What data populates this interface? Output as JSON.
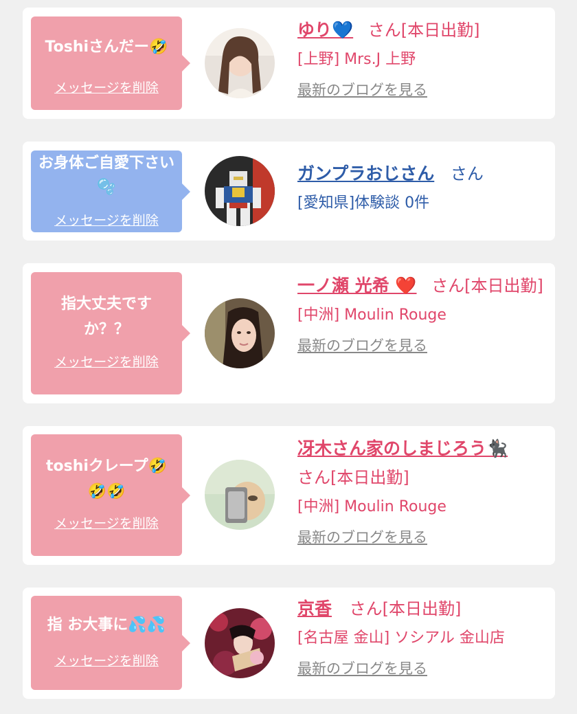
{
  "items": [
    {
      "message": "Toshiさんだー🤣",
      "delete_label": "メッセージを削除",
      "name": "ゆり💙",
      "suffix": "さん[本日出勤]",
      "shop": "[上野] Mrs.J 上野",
      "blog_label": "最新のブログを見る"
    },
    {
      "message": "お身体ご自愛下さい🫧",
      "delete_label": "メッセージを削除",
      "name": "ガンプラおじさん",
      "suffix": "さん",
      "shop": "[愛知県]体験談 0件"
    },
    {
      "message": "指大丈夫ですか？？",
      "delete_label": "メッセージを削除",
      "name": "一ノ瀬 光希 ❤️",
      "suffix": "さん[本日出勤]",
      "shop": "[中洲] Moulin Rouge",
      "blog_label": "最新のブログを見る"
    },
    {
      "message": "toshiクレープ🤣🤣🤣",
      "delete_label": "メッセージを削除",
      "name": "冴木さん家のしまじろう🐈‍⬛",
      "suffix": "さん[本日出勤]",
      "shop": "[中洲] Moulin Rouge",
      "blog_label": "最新のブログを見る"
    },
    {
      "message": "指 お大事に💦💦",
      "delete_label": "メッセージを削除",
      "name": "京香",
      "suffix": "さん[本日出勤]",
      "shop": "[名古屋 金山] ソシアル 金山店",
      "blog_label": "最新のブログを見る"
    }
  ],
  "colors": {
    "bubble_pink": "#f0a0ab",
    "bubble_blue": "#93b3ee",
    "text_pink": "#e0466a",
    "text_blue": "#2e5ca8",
    "link_gray": "#888888"
  }
}
